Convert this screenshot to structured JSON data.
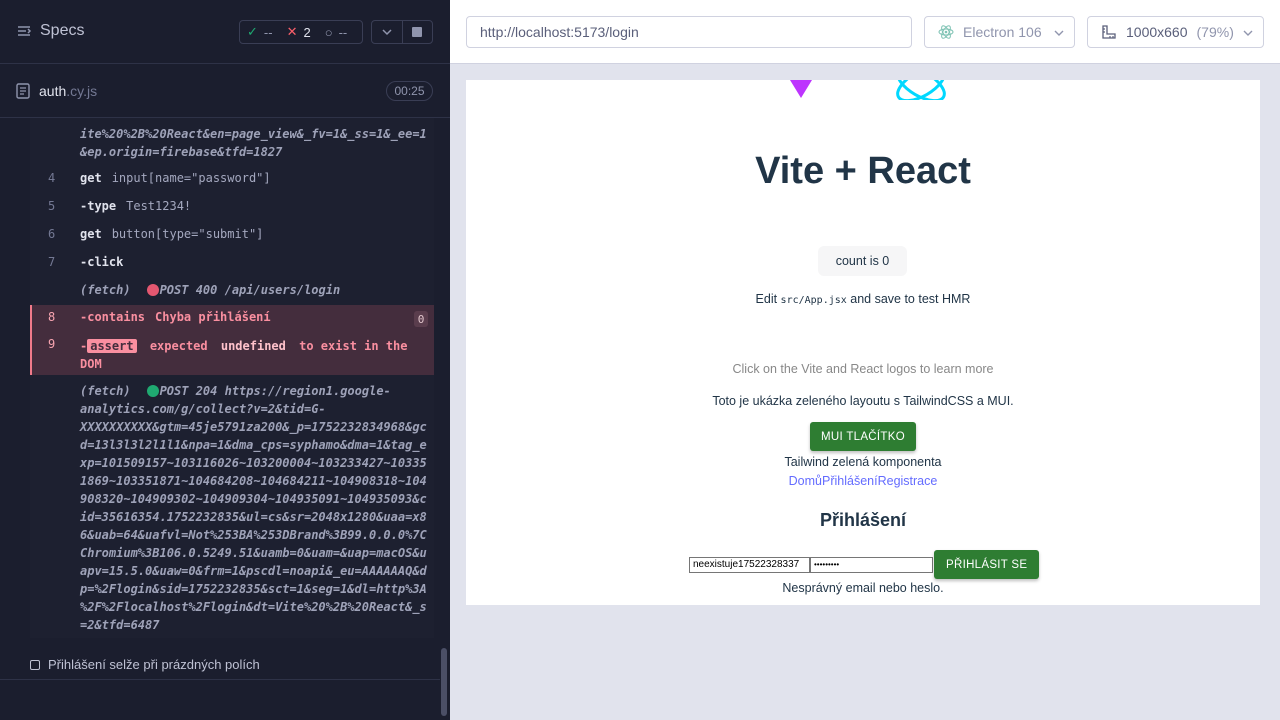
{
  "reporter": {
    "specs_label": "Specs",
    "stats": {
      "passed": "--",
      "failed": "2",
      "pending": "--"
    },
    "spec_file": {
      "name": "auth",
      "ext": ".cy.js"
    },
    "timer": "00:25",
    "log": {
      "frag_top": "ite%20%2B%20React&en=page_view&_fv=1&_ss=1&_ee=1\n&ep.origin=firebase&tfd=1827",
      "rows": [
        {
          "num": "4",
          "cmd": "get",
          "arg": "input[name=\"password\"]"
        },
        {
          "num": "5",
          "cmd": "-type",
          "arg": "Test1234!"
        },
        {
          "num": "6",
          "cmd": "get",
          "arg": "button[type=\"submit\"]"
        },
        {
          "num": "7",
          "cmd": "-click",
          "arg": ""
        }
      ],
      "fetch1": {
        "label": "(fetch)",
        "text": "POST 400 /api/users/login"
      },
      "err_row8": {
        "num": "8",
        "cmd": "-contains",
        "arg": "Chyba přihlášení",
        "count": "0"
      },
      "err_row9": {
        "num": "9",
        "dash": "-",
        "badge": "assert",
        "pre": "expected",
        "strong1": "undefined",
        "mid": "to exist in the",
        "end": "DOM"
      },
      "fetch2": {
        "label": "(fetch)",
        "first": "POST 204 https://region1.google-",
        "rest": "analytics.com/g/collect?v=2&tid=G-\nXXXXXXXXXX&gtm=45je5791za200&_p=1752232834968&gc\nd=13l3l3l2l1l1&npa=1&dma_cps=syphamo&dma=1&tag_e\nxp=101509157~103116026~103200004~103233427~10335\n1869~103351871~104684208~104684211~104908318~104\n908320~104909302~104909304~104935091~104935093&c\nid=35616354.1752232835&ul=cs&sr=2048x1280&uaa=x8\n6&uab=64&uafvl=Not%253BA%253DBrand%3B99.0.0.0%7C\nChromium%3B106.0.5249.51&uamb=0&uam=&uap=macOS&u\napv=15.5.0&uaw=0&frm=1&pscdl=noapi&_eu=AAAAAAQ&d\np=%2Flogin&sid=1752232835&sct=1&seg=1&dl=http%3A\n%2F%2Flocalhost%2Flogin&dt=Vite%20%2B%20React&_s\n=2&tfd=6487"
      }
    },
    "subtest": "Přihlášení selže při prázdných polích"
  },
  "aut": {
    "url": "http://localhost:5173/login",
    "browser": "Electron 106",
    "viewport": "1000x660",
    "zoom": "(79%)"
  },
  "app": {
    "title": "Vite + React",
    "count_button": "count is 0",
    "edit_pre": "Edit ",
    "edit_code": "src/App.jsx",
    "edit_post": " and save to test HMR",
    "read_docs": "Click on the Vite and React logos to learn more",
    "intro": "Toto je ukázka zeleného layoutu s TailwindCSS a MUI.",
    "mui_button": "MUI TLAČÍTKO",
    "tailwind": "Tailwind zelená komponenta",
    "links": [
      "Domů",
      "Přihlášení",
      "Registrace"
    ],
    "login_heading": "Přihlášení",
    "email_value": "neexistuje17522328337",
    "password_value": "•••••••••",
    "submit": "PŘIHLÁSIT SE",
    "error": "Nesprávný email nebo heslo."
  },
  "colors": {
    "pass": "#1fa971",
    "fail": "#fa5f6a",
    "mui_green": "#2e7d32",
    "link": "#646cff"
  }
}
